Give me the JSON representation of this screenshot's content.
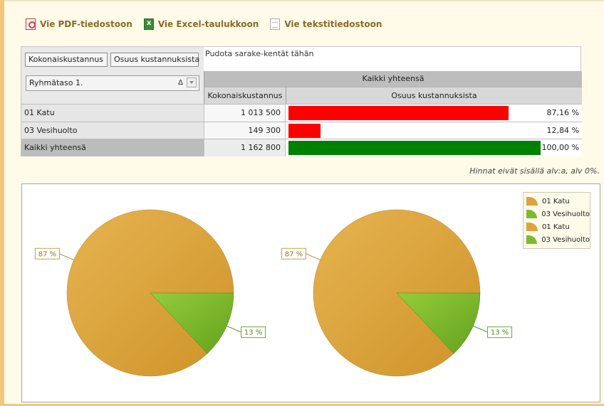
{
  "toolbar": {
    "pdf_label": "Vie PDF-tiedostoon",
    "excel_label": "Vie Excel-taulukkoon",
    "text_label": "Vie tekstitiedostoon"
  },
  "pivot": {
    "data_fields": [
      "Kokonaiskustannus",
      "Osuus kustannuksista"
    ],
    "drop_hint": "Pudota sarake-kentät tähän",
    "row_field": "Ryhmätaso 1.",
    "sort_glyph": "Δ",
    "grand_header": "Kaikki yhteensä",
    "col_headers": [
      "Kokonaiskustannus",
      "Osuus kustannuksista"
    ],
    "rows": [
      {
        "label": "01 Katu",
        "value": "1 013 500",
        "share": "87,16 %",
        "share_num": 0.8716,
        "bar_color": "#ff0000"
      },
      {
        "label": "03 Vesihuolto",
        "value": "149 300",
        "share": "12,84 %",
        "share_num": 0.1284,
        "bar_color": "#ff0000"
      },
      {
        "label": "Kaikki yhteensä",
        "value": "1 162 800",
        "share": "100,00 %",
        "share_num": 1.0,
        "bar_color": "#008000"
      }
    ]
  },
  "note": "Hinnat eivät sisällä alv:a, alv 0%.",
  "chart_data": [
    {
      "type": "pie",
      "categories": [
        "01 Katu",
        "03 Vesihuolto"
      ],
      "values": [
        87,
        13
      ],
      "labels": [
        "87 %",
        "13 %"
      ],
      "colors": [
        "#dba341",
        "#7cba2f"
      ]
    },
    {
      "type": "pie",
      "categories": [
        "01 Katu",
        "03 Vesihuolto"
      ],
      "values": [
        87,
        13
      ],
      "labels": [
        "87 %",
        "13 %"
      ],
      "colors": [
        "#dba341",
        "#7cba2f"
      ]
    }
  ],
  "legend": [
    {
      "label": "01 Katu",
      "color": "#dba341"
    },
    {
      "label": "03 Vesihuolto",
      "color": "#7cba2f"
    },
    {
      "label": "01 Katu",
      "color": "#dba341"
    },
    {
      "label": "03 Vesihuolto",
      "color": "#7cba2f"
    }
  ]
}
